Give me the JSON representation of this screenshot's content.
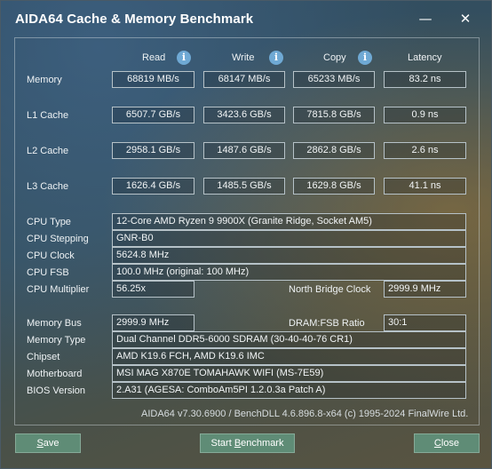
{
  "window": {
    "title": "AIDA64 Cache & Memory Benchmark",
    "minimize_glyph": "—",
    "close_glyph": "✕"
  },
  "headers": {
    "read": "Read",
    "write": "Write",
    "copy": "Copy",
    "latency": "Latency",
    "info_glyph": "i"
  },
  "bench_rows": [
    {
      "label": "Memory",
      "read": "68819 MB/s",
      "write": "68147 MB/s",
      "copy": "65233 MB/s",
      "latency": "83.2 ns"
    },
    {
      "label": "L1 Cache",
      "read": "6507.7 GB/s",
      "write": "3423.6 GB/s",
      "copy": "7815.8 GB/s",
      "latency": "0.9 ns"
    },
    {
      "label": "L2 Cache",
      "read": "2958.1 GB/s",
      "write": "1487.6 GB/s",
      "copy": "2862.8 GB/s",
      "latency": "2.6 ns"
    },
    {
      "label": "L3 Cache",
      "read": "1626.4 GB/s",
      "write": "1485.5 GB/s",
      "copy": "1629.8 GB/s",
      "latency": "41.1 ns"
    }
  ],
  "cpu": {
    "type_label": "CPU Type",
    "type_value": "12-Core AMD Ryzen 9 9900X  (Granite Ridge, Socket AM5)",
    "stepping_label": "CPU Stepping",
    "stepping_value": "GNR-B0",
    "clock_label": "CPU Clock",
    "clock_value": "5624.8 MHz",
    "fsb_label": "CPU FSB",
    "fsb_value": "100.0 MHz  (original: 100 MHz)",
    "multiplier_label": "CPU Multiplier",
    "multiplier_value": "56.25x",
    "nb_clock_label": "North Bridge Clock",
    "nb_clock_value": "2999.9 MHz"
  },
  "memory": {
    "bus_label": "Memory Bus",
    "bus_value": "2999.9 MHz",
    "ratio_label": "DRAM:FSB Ratio",
    "ratio_value": "30:1",
    "type_label": "Memory Type",
    "type_value": "Dual Channel DDR5-6000 SDRAM  (30-40-40-76 CR1)",
    "chipset_label": "Chipset",
    "chipset_value": "AMD K19.6 FCH, AMD K19.6 IMC",
    "motherboard_label": "Motherboard",
    "motherboard_value": "MSI MAG X870E TOMAHAWK WIFI (MS-7E59)",
    "bios_label": "BIOS Version",
    "bios_value": "2.A31  (AGESA: ComboAm5PI 1.2.0.3a Patch A)"
  },
  "footer": {
    "version_note": "AIDA64 v7.30.6900 / BenchDLL 4.6.896.8-x64  (c) 1995-2024 FinalWire Ltd."
  },
  "buttons": {
    "save_underlined": "S",
    "save_rest": "ave",
    "start_pre": "Start ",
    "start_underlined": "B",
    "start_rest": "enchmark",
    "close_underlined": "C",
    "close_rest": "lose"
  }
}
